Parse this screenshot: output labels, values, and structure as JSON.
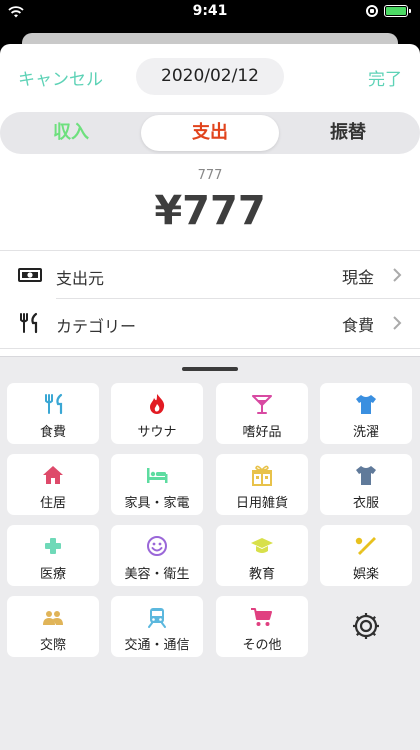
{
  "status": {
    "time": "9:41"
  },
  "nav": {
    "cancel": "キャンセル",
    "date": "2020/02/12",
    "done": "完了"
  },
  "segments": {
    "income": "収入",
    "expense": "支出",
    "transfer": "振替",
    "selected": "expense"
  },
  "amount": {
    "input": "777",
    "display": "¥777"
  },
  "fields": {
    "source": {
      "label": "支出元",
      "value": "現金",
      "icon": "cash-icon"
    },
    "category": {
      "label": "カテゴリー",
      "value": "食費",
      "icon": "utensils-icon"
    }
  },
  "categories": [
    {
      "label": "食費",
      "icon": "utensils-icon",
      "color": "#3aa7d4"
    },
    {
      "label": "サウナ",
      "icon": "fire-icon",
      "color": "#e21b23"
    },
    {
      "label": "嗜好品",
      "icon": "cocktail-icon",
      "color": "#d84aa2"
    },
    {
      "label": "洗濯",
      "icon": "shirt-icon",
      "color": "#3a8fe0"
    },
    {
      "label": "住居",
      "icon": "house-icon",
      "color": "#de4a6a"
    },
    {
      "label": "家具・家電",
      "icon": "bed-icon",
      "color": "#5ddca0"
    },
    {
      "label": "日用雑貨",
      "icon": "gift-icon",
      "color": "#e8c24a"
    },
    {
      "label": "衣服",
      "icon": "tshirt-icon",
      "color": "#607a9a"
    },
    {
      "label": "医療",
      "icon": "medical-cross-icon",
      "color": "#6fd9b8"
    },
    {
      "label": "美容・衛生",
      "icon": "smile-icon",
      "color": "#9a67d8"
    },
    {
      "label": "教育",
      "icon": "graduation-cap-icon",
      "color": "#d8e04a"
    },
    {
      "label": "娯楽",
      "icon": "baseball-icon",
      "color": "#e8c11e"
    },
    {
      "label": "交際",
      "icon": "people-icon",
      "color": "#e0b458"
    },
    {
      "label": "交通・通信",
      "icon": "train-icon",
      "color": "#5cb8de"
    },
    {
      "label": "その他",
      "icon": "cart-icon",
      "color": "#e04080"
    }
  ],
  "settings": {
    "icon": "gear-icon"
  }
}
